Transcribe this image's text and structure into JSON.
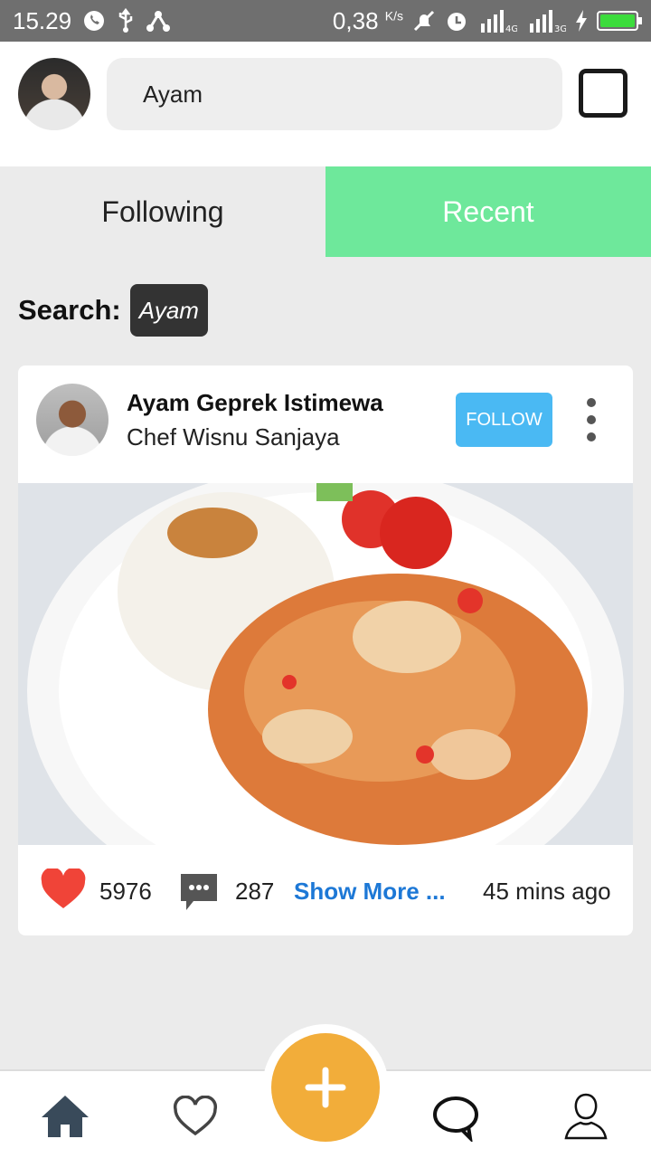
{
  "status_bar": {
    "time": "15.29",
    "net_speed": "0,38",
    "net_unit": "K/s",
    "net_4g": "4G",
    "net_3g": "3G"
  },
  "header": {
    "search_value": "Ayam"
  },
  "tabs": [
    {
      "label": "Following",
      "active": false
    },
    {
      "label": "Recent",
      "active": true,
      "color": "#6ee89b"
    }
  ],
  "search_filter": {
    "label": "Search:",
    "chip": "Ayam"
  },
  "post": {
    "title": "Ayam Geprek Istimewa",
    "author": "Chef Wisnu Sanjaya",
    "follow_label": "FOLLOW",
    "likes": "5976",
    "comments": "287",
    "show_more": "Show More ...",
    "time_ago": "45 mins ago"
  },
  "colors": {
    "accent_green": "#6ee89b",
    "follow_blue": "#4ab9f3",
    "fab_orange": "#f2ad3a",
    "link_blue": "#1d78d6",
    "heart_red": "#f04438"
  },
  "bottom_nav": {
    "items": [
      "home-icon",
      "heart-icon",
      "add-icon",
      "chat-icon",
      "profile-icon"
    ]
  }
}
